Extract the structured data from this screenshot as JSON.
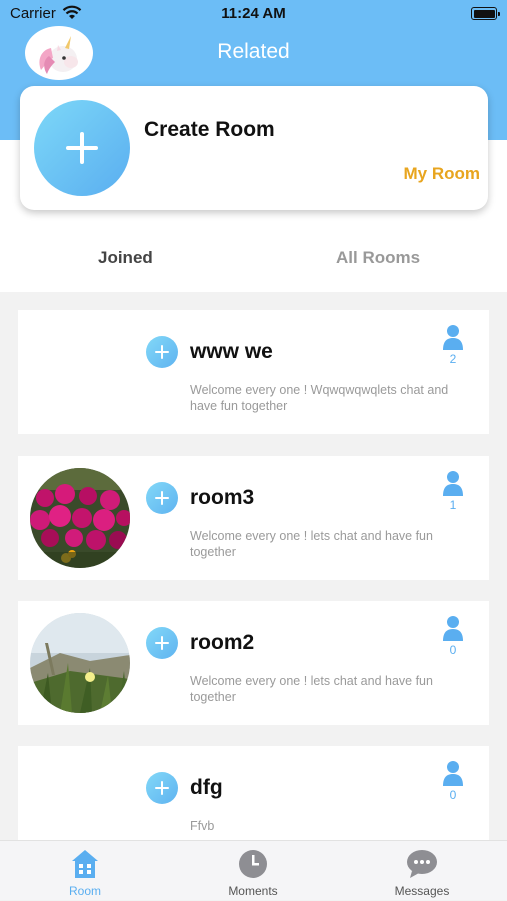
{
  "status_bar": {
    "carrier": "Carrier",
    "time": "11:24 AM"
  },
  "header": {
    "title": "Related",
    "avatar": "unicorn-avatar"
  },
  "create_card": {
    "title": "Create Room",
    "my_room_label": "My Room"
  },
  "tabs": [
    {
      "label": "Joined",
      "active": true
    },
    {
      "label": "All Rooms",
      "active": false
    }
  ],
  "rooms": [
    {
      "name": "www we",
      "description": "Welcome every one ! Wqwqwqwqlets chat and have fun together",
      "members": "2",
      "image": "none"
    },
    {
      "name": "room3",
      "description": "Welcome every one ! lets chat and have fun together",
      "members": "1",
      "image": "pink-flowers-photo"
    },
    {
      "name": "room2",
      "description": "Welcome every one ! lets chat and have fun together",
      "members": "0",
      "image": "coastal-grass-photo"
    },
    {
      "name": "dfg",
      "description": "Ffvb",
      "members": "0",
      "image": "none"
    }
  ],
  "tabbar": [
    {
      "label": "Room",
      "icon": "house-icon",
      "active": true
    },
    {
      "label": "Moments",
      "icon": "clock-icon",
      "active": false
    },
    {
      "label": "Messages",
      "icon": "chat-bubble-icon",
      "active": false
    }
  ],
  "colors": {
    "header": "#6cbdf6",
    "accent": "#5aaef0",
    "my_room": "#e8a51f",
    "tab_inactive": "#999999"
  }
}
